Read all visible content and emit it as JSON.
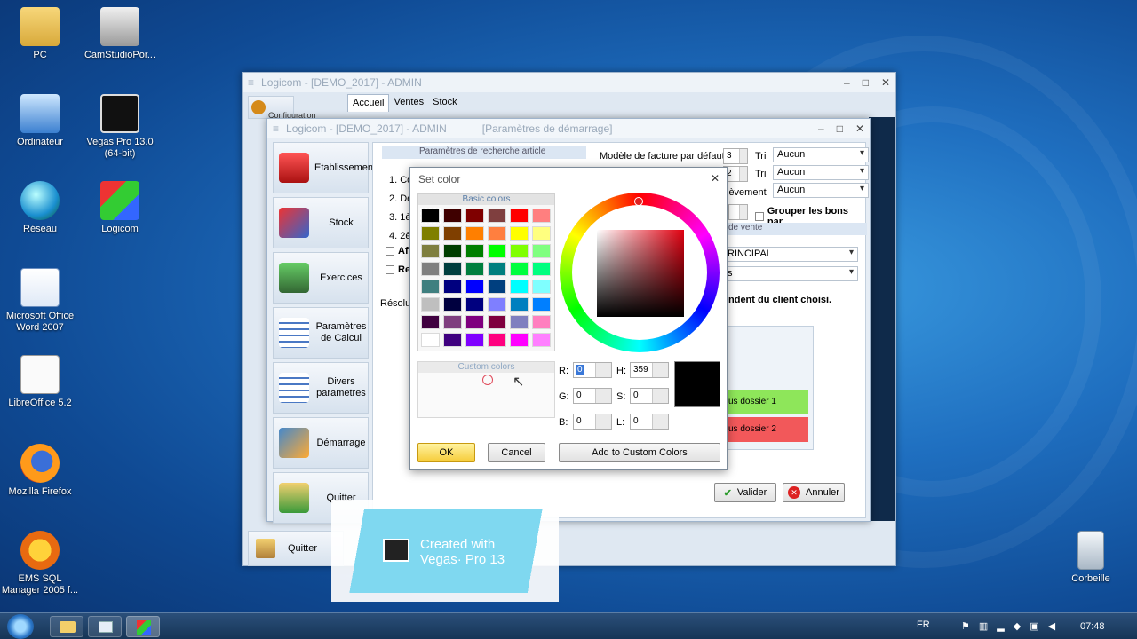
{
  "desktop": {
    "icons": [
      {
        "label": "PC"
      },
      {
        "label": "CamStudioPor..."
      },
      {
        "label": "Ordinateur"
      },
      {
        "label": "Vegas Pro 13.0 (64-bit)"
      },
      {
        "label": "Réseau"
      },
      {
        "label": "Logicom"
      },
      {
        "label": "Microsoft Office Word 2007"
      },
      {
        "label": "LibreOffice 5.2"
      },
      {
        "label": "Mozilla Firefox"
      },
      {
        "label": "EMS SQL Manager 2005 f..."
      },
      {
        "label": "Corbeille"
      }
    ]
  },
  "main_window": {
    "title": "Logicom - [DEMO_2017] - ADMIN",
    "tabs": [
      {
        "label": "Accueil"
      },
      {
        "label": "Ventes"
      },
      {
        "label": "Stock"
      }
    ],
    "sidebar_top_label": "Configuration",
    "sidebar_bottom_label": "Quitter"
  },
  "settings_window": {
    "title": "Logicom - [DEMO_2017] - ADMIN",
    "subtitle": "[Paramètres de démarrage]",
    "nav": [
      {
        "label": "Etablissement"
      },
      {
        "label": "Stock"
      },
      {
        "label": "Exercices"
      },
      {
        "label": "Paramètres de Calcul"
      },
      {
        "label": "Divers parametres"
      },
      {
        "label": "Démarrage"
      },
      {
        "label": "Quitter"
      }
    ],
    "search_group_title": "Paramètres de recherche article",
    "search_items": [
      "1. Co",
      "2. De",
      "3. 1è",
      "4. 2è"
    ],
    "checkbox_items": [
      "Aff",
      "Re"
    ],
    "resolution_label": "Résolu",
    "invoice_model_label": "Modèle de facture par défaut",
    "invoice_model_value": "3",
    "tri_label_1": "Tri",
    "tri_label_2": "Tri",
    "combo_1": "Aucun",
    "combo_2": "Aucun",
    "combo_3": "Aucun",
    "row2_value": "2",
    "prelevement_label": "lèvement",
    "grouper_label": "Grouper les bons par",
    "vente_label": "de vente",
    "principal_combo": "RINCIPAL",
    "s_combo": "s",
    "client_note": "ndent du client choisi.",
    "dossier1": "us dossier 1",
    "dossier2": "us dossier 2",
    "valider": "Valider",
    "annuler": "Annuler"
  },
  "color_dialog": {
    "title": "Set color",
    "basic_colors_label": "Basic colors",
    "custom_colors_label": "Custom colors",
    "r_label": "R:",
    "r_value": "0",
    "g_label": "G:",
    "g_value": "0",
    "b_label": "B:",
    "b_value": "0",
    "h_label": "H:",
    "h_value": "359",
    "s_label": "S:",
    "s_value": "0",
    "l_label": "L:",
    "l_value": "0",
    "ok": "OK",
    "cancel": "Cancel",
    "add_custom": "Add to Custom Colors",
    "preview_color": "#000000",
    "basic_colors": [
      "#000000",
      "#3f0000",
      "#7f0000",
      "#7f3f3f",
      "#ff0000",
      "#ff7f7f",
      "#7f7f00",
      "#7f3f00",
      "#ff7f00",
      "#ff7f3f",
      "#ffff00",
      "#ffff7f",
      "#7f7f3f",
      "#003f00",
      "#007f00",
      "#00ff00",
      "#7fff00",
      "#7fff7f",
      "#7f7f7f",
      "#003f3f",
      "#007f3f",
      "#007f7f",
      "#00ff3f",
      "#00ff7f",
      "#3f7f7f",
      "#00007f",
      "#0000ff",
      "#003f7f",
      "#00ffff",
      "#7fffff",
      "#bfbfbf",
      "#00003f",
      "#00007f",
      "#7f7fff",
      "#007fbf",
      "#007fff",
      "#3f003f",
      "#7f3f7f",
      "#7f007f",
      "#7f003f",
      "#7f7fbf",
      "#ff7fbf",
      "#ffffff",
      "#3f007f",
      "#7f00ff",
      "#ff007f",
      "#ff00ff",
      "#ff7fff"
    ]
  },
  "watermark": {
    "line1": "Created with",
    "line2": "Vegas· Pro 13"
  },
  "taskbar": {
    "lang": "FR",
    "clock": "07:48"
  }
}
